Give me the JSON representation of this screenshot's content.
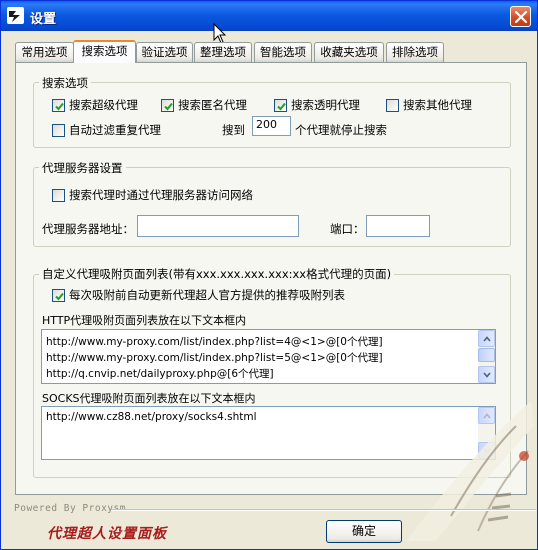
{
  "window": {
    "title": "设置"
  },
  "tabs": [
    {
      "label": "常用选项"
    },
    {
      "label": "搜索选项"
    },
    {
      "label": "验证选项"
    },
    {
      "label": "整理选项"
    },
    {
      "label": "智能选项"
    },
    {
      "label": "收藏夹选项"
    },
    {
      "label": "排除选项"
    }
  ],
  "active_tab": "搜索选项",
  "search_options": {
    "title": "搜索选项",
    "checkboxes": [
      {
        "label": "搜索超级代理",
        "checked": true
      },
      {
        "label": "搜索匿名代理",
        "checked": true
      },
      {
        "label": "搜索透明代理",
        "checked": true
      },
      {
        "label": "搜索其他代理",
        "checked": false
      },
      {
        "label": "自动过滤重复代理",
        "checked": false
      }
    ],
    "stop_prefix": "搜到",
    "stop_count": "200",
    "stop_suffix": "个代理就停止搜索"
  },
  "proxy_server": {
    "title": "代理服务器设置",
    "use_proxy_label": "搜索代理时通过代理服务器访问网络",
    "use_proxy_checked": false,
    "address_label": "代理服务器地址：",
    "address_value": "",
    "port_label": "端口：",
    "port_value": ""
  },
  "custom_pages": {
    "title": "自定义代理吸附页面列表(带有xxx.xxx.xxx.xxx:xx格式代理的页面)",
    "auto_update_label": "每次吸附前自动更新代理超人官方提供的推荐吸附列表",
    "auto_update_checked": true,
    "http_label": "HTTP代理吸附页面列表放在以下文本框内",
    "http_lines": [
      "http://www.my-proxy.com/list/index.php?list=4@<1>@[0个代理]",
      "http://www.my-proxy.com/list/index.php?list=5@<1>@[0个代理]",
      "http://q.cnvip.net/dailyproxy.php@[6个代理]"
    ],
    "socks_label": "SOCKS代理吸附页面列表放在以下文本框内",
    "socks_lines": [
      "http://www.cz88.net/proxy/socks4.shtml"
    ]
  },
  "footer": {
    "powered_by": "Powered By Proxysm",
    "app_name": "代理超人设置面板",
    "ok_label": "确定"
  },
  "colors": {
    "titlebar": "#0a5ee8",
    "active_tab_accent": "#e68b2c",
    "footer_title": "#a81c1c"
  },
  "icons": {
    "app": "app-logo-icon",
    "close": "close-icon",
    "check": "checkmark-icon",
    "cursor": "mouse-cursor-icon"
  }
}
